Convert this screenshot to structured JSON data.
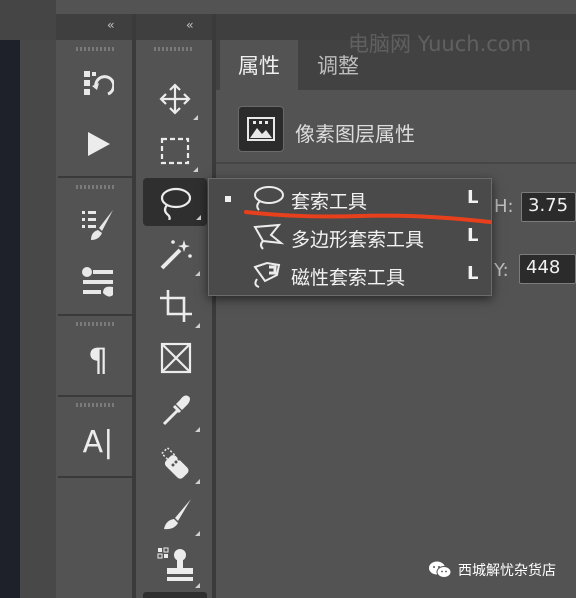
{
  "collapse_left": "‹‹",
  "collapse_right": "‹‹",
  "panels": {
    "tabs": [
      {
        "label": "属性",
        "active": true
      },
      {
        "label": "调整",
        "active": false
      }
    ],
    "layer_title": "像素图层属性",
    "fields": {
      "h_label": "H:",
      "h_value": "3.75",
      "y_label": "Y:",
      "y_value": "448"
    }
  },
  "panel_icons_col1": [
    "history-icon",
    "play-action-icon",
    "brush-settings-icon",
    "brush-presets-icon",
    "paragraph-icon",
    "character-icon"
  ],
  "char_glyph": "A|",
  "para_glyph": "¶",
  "toolbar_icons": [
    "move-icon",
    "marquee-icon",
    "lasso-icon",
    "magic-wand-icon",
    "crop-icon",
    "frame-icon",
    "eyedropper-icon",
    "healing-brush-icon",
    "brush-icon",
    "clone-stamp-icon"
  ],
  "flyout": {
    "items": [
      {
        "label": "套索工具",
        "key": "L",
        "icon": "lasso-icon",
        "selected": true
      },
      {
        "label": "多边形套索工具",
        "key": "L",
        "icon": "polygonal-lasso-icon",
        "selected": false
      },
      {
        "label": "磁性套索工具",
        "key": "L",
        "icon": "magnetic-lasso-icon",
        "selected": false
      }
    ]
  },
  "watermark": "电脑网 Yuuch.com",
  "wechat_account": "西城解忧杂货店",
  "colors": {
    "panel_bg": "#535353",
    "menu_bg": "#4a4a4a",
    "annotation_red": "#e8401c"
  }
}
